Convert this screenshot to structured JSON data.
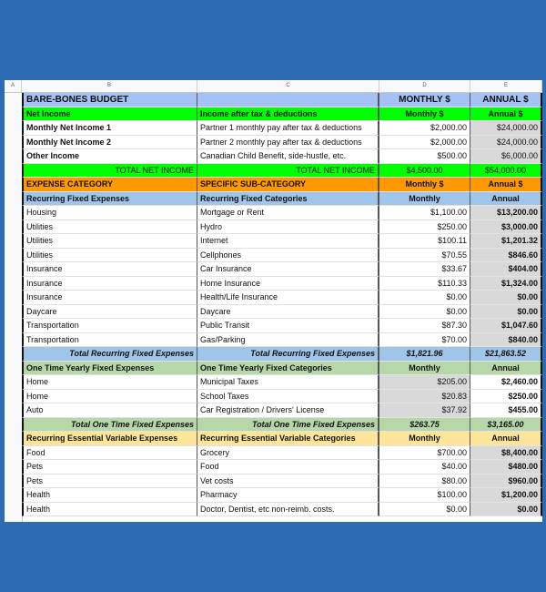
{
  "colors": {
    "background": "#2d6cb5",
    "title_blue": "#a4c2f4",
    "income_green": "#00ff00",
    "expense_orange": "#ff9900",
    "recurring_blue": "#9fc5e8",
    "one_time_green": "#b6d7a8",
    "variable_yellow": "#ffe599",
    "calc_grey": "#d9d9d9"
  },
  "column_headers": [
    "A",
    "B",
    "C",
    "D",
    "E"
  ],
  "rows": [
    {
      "type": "title",
      "b": "BARE-BONES BUDGET",
      "c": "",
      "d": "MONTHLY $",
      "e": "ANNUAL $"
    },
    {
      "type": "income-header",
      "b": "Net Income",
      "c": "Income after tax & deductions",
      "d": "Monthly $",
      "e": "Annual $"
    },
    {
      "type": "income",
      "b": "Monthly Net Income 1",
      "c": "Partner 1 monthly pay after tax & deductions",
      "d": "$2,000.00",
      "e": "$24,000.00"
    },
    {
      "type": "income",
      "b": "Monthly Net Income 2",
      "c": "Partner 2 monthly pay after tax & deductions",
      "d": "$2,000.00",
      "e": "$24,000.00"
    },
    {
      "type": "income",
      "b": "Other Income",
      "c": "Canadian Child Benefit, side-hustle, etc.",
      "d": "$500.00",
      "e": "$6,000.00"
    },
    {
      "type": "income-total",
      "b": "TOTAL NET INCOME",
      "c": "TOTAL NET INCOME",
      "d": "$4,500.00",
      "e": "$54,000.00"
    },
    {
      "type": "expense-header",
      "b": "EXPENSE CATEGORY",
      "c": "SPECIFIC SUB-CATEGORY",
      "d": "Monthly $",
      "e": "Annual $"
    },
    {
      "type": "recurring-header",
      "b": "Recurring Fixed Expenses",
      "c": "Recurring Fixed Categories",
      "d": "Monthly",
      "e": "Annual"
    },
    {
      "type": "recurring",
      "b": "Housing",
      "c": "Mortgage or Rent",
      "d": "$1,100.00",
      "e": "$13,200.00"
    },
    {
      "type": "recurring",
      "b": "Utilities",
      "c": "Hydro",
      "d": "$250.00",
      "e": "$3,000.00"
    },
    {
      "type": "recurring",
      "b": "Utilities",
      "c": "Internet",
      "d": "$100.11",
      "e": "$1,201.32"
    },
    {
      "type": "recurring",
      "b": "Utilities",
      "c": "Cellphones",
      "d": "$70.55",
      "e": "$846.60"
    },
    {
      "type": "recurring",
      "b": "Insurance",
      "c": "Car Insurance",
      "d": "$33.67",
      "e": "$404.00"
    },
    {
      "type": "recurring",
      "b": "Insurance",
      "c": "Home Insurance",
      "d": "$110.33",
      "e": "$1,324.00"
    },
    {
      "type": "recurring",
      "b": "Insurance",
      "c": "Health/Life Insurance",
      "d": "$0.00",
      "e": "$0.00"
    },
    {
      "type": "recurring",
      "b": "Daycare",
      "c": "Daycare",
      "d": "$0.00",
      "e": "$0.00"
    },
    {
      "type": "recurring",
      "b": "Transportation",
      "c": "Public Transit",
      "d": "$87.30",
      "e": "$1,047.60"
    },
    {
      "type": "recurring",
      "b": "Transportation",
      "c": "Gas/Parking",
      "d": "$70.00",
      "e": "$840.00"
    },
    {
      "type": "recurring-total",
      "b": "Total Recurring Fixed Expenses",
      "c": "Total Recurring Fixed Expenses",
      "d": "$1,821.96",
      "e": "$21,863.52"
    },
    {
      "type": "onetime-header",
      "b": "One Time Yearly Fixed Expenses",
      "c": "One Time Yearly Fixed Categories",
      "d": "Monthly",
      "e": "Annual"
    },
    {
      "type": "onetime",
      "b": "Home",
      "c": "Municipal Taxes",
      "d": "$205.00",
      "e": "$2,460.00"
    },
    {
      "type": "onetime",
      "b": "Home",
      "c": "School Taxes",
      "d": "$20.83",
      "e": "$250.00"
    },
    {
      "type": "onetime",
      "b": "Auto",
      "c": "Car Registration / Drivers' License",
      "d": "$37.92",
      "e": "$455.00"
    },
    {
      "type": "onetime-total",
      "b": "Total One Time Fixed Expenses",
      "c": "Total One Time Fixed Expenses",
      "d": "$263.75",
      "e": "$3,165.00"
    },
    {
      "type": "variable-header",
      "b": "Recurring Essential Variable Expenses",
      "c": "Recurring Essential Variable Categories",
      "d": "Monthly",
      "e": "Annual"
    },
    {
      "type": "variable",
      "b": "Food",
      "c": "Grocery",
      "d": "$700.00",
      "e": "$8,400.00"
    },
    {
      "type": "variable",
      "b": "Pets",
      "c": "Food",
      "d": "$40.00",
      "e": "$480.00"
    },
    {
      "type": "variable",
      "b": "Pets",
      "c": "Vet costs",
      "d": "$80.00",
      "e": "$960.00"
    },
    {
      "type": "variable",
      "b": "Health",
      "c": "Pharmacy",
      "d": "$100.00",
      "e": "$1,200.00"
    },
    {
      "type": "variable",
      "b": "Health",
      "c": "Doctor, Dentist, etc non-reimb. costs.",
      "d": "$0.00",
      "e": "$0.00"
    }
  ]
}
